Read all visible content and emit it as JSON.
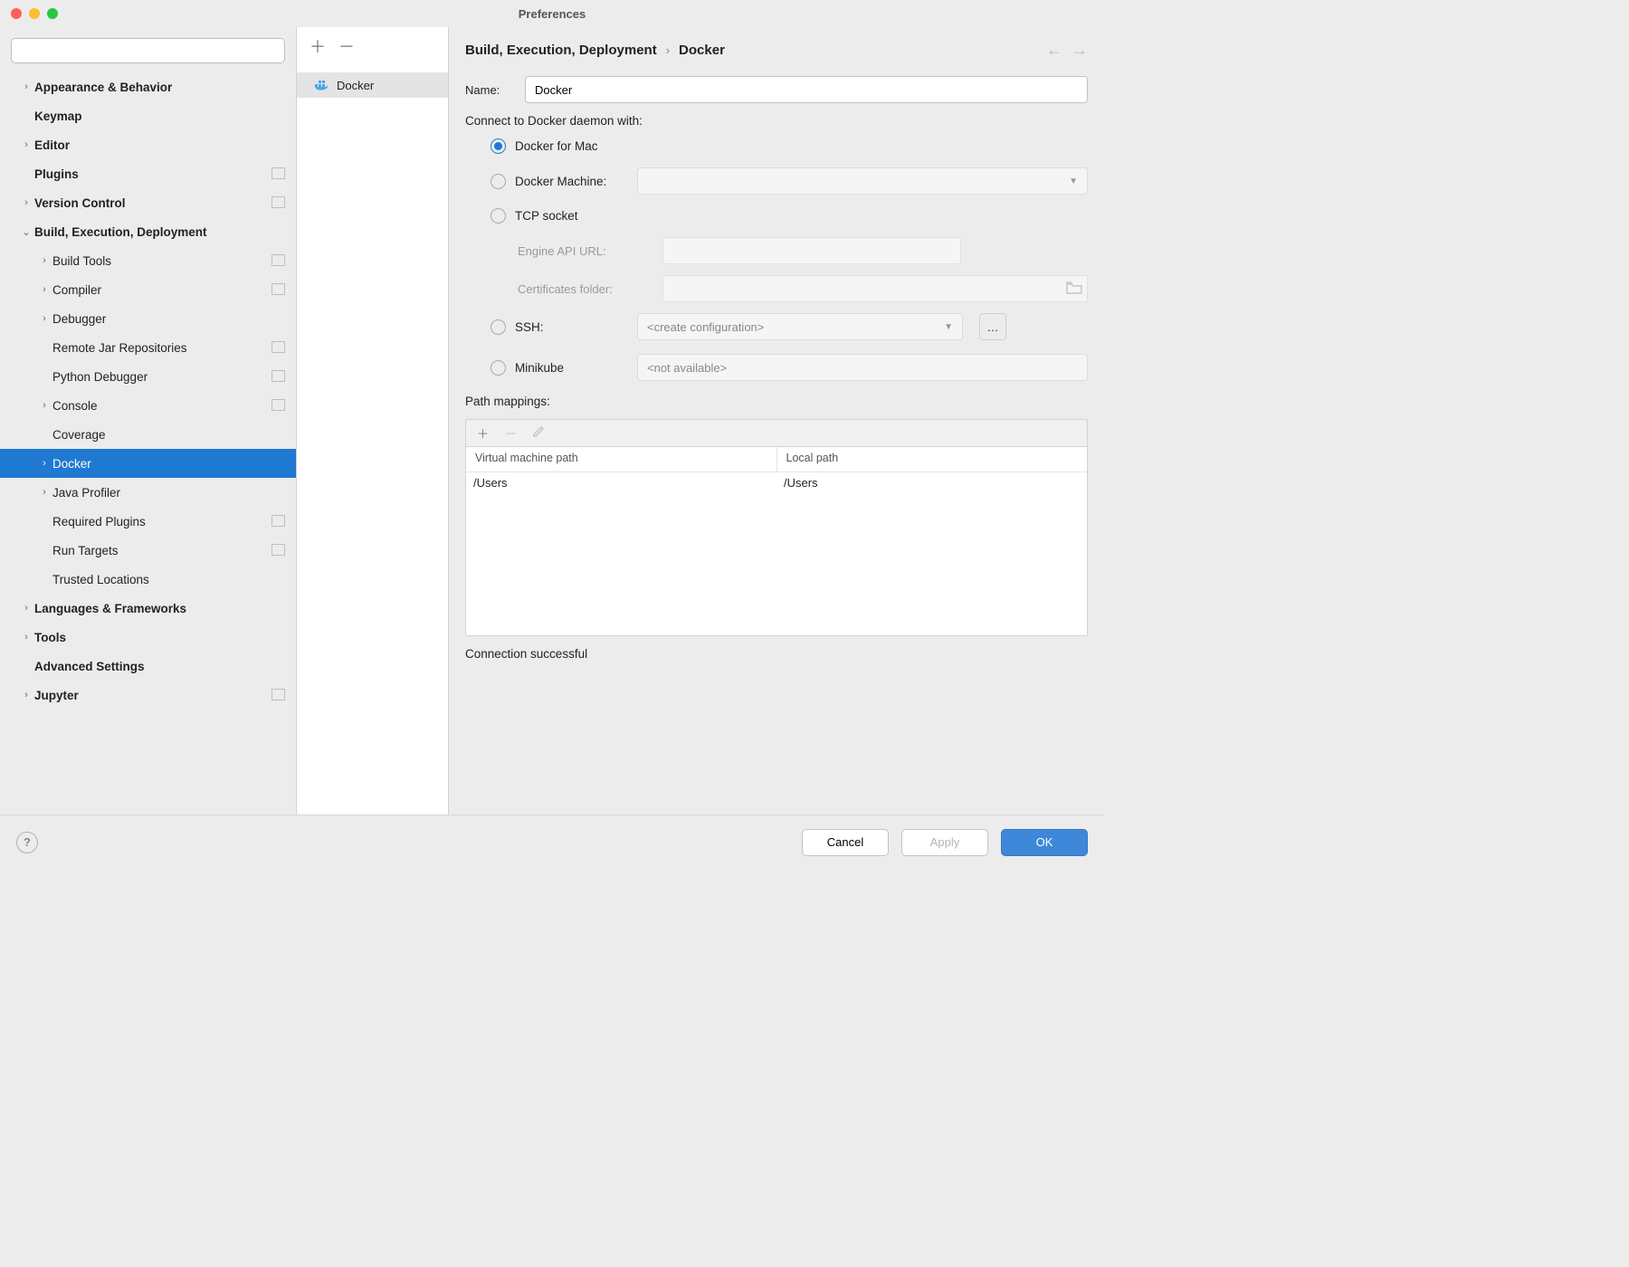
{
  "window": {
    "title": "Preferences"
  },
  "search": {
    "placeholder": ""
  },
  "sidebar": [
    {
      "label": "Appearance & Behavior",
      "bold": true,
      "arrow": ">",
      "level": 0
    },
    {
      "label": "Keymap",
      "bold": true,
      "arrow": "",
      "level": 0
    },
    {
      "label": "Editor",
      "bold": true,
      "arrow": ">",
      "level": 0
    },
    {
      "label": "Plugins",
      "bold": true,
      "arrow": "",
      "level": 0,
      "badge": true
    },
    {
      "label": "Version Control",
      "bold": true,
      "arrow": ">",
      "level": 0,
      "badge": true
    },
    {
      "label": "Build, Execution, Deployment",
      "bold": true,
      "arrow": "v",
      "level": 0
    },
    {
      "label": "Build Tools",
      "bold": false,
      "arrow": ">",
      "level": 1,
      "badge": true
    },
    {
      "label": "Compiler",
      "bold": false,
      "arrow": ">",
      "level": 1,
      "badge": true
    },
    {
      "label": "Debugger",
      "bold": false,
      "arrow": ">",
      "level": 1
    },
    {
      "label": "Remote Jar Repositories",
      "bold": false,
      "arrow": "",
      "level": 1,
      "badge": true
    },
    {
      "label": "Python Debugger",
      "bold": false,
      "arrow": "",
      "level": 1,
      "badge": true
    },
    {
      "label": "Console",
      "bold": false,
      "arrow": ">",
      "level": 1,
      "badge": true
    },
    {
      "label": "Coverage",
      "bold": false,
      "arrow": "",
      "level": 1
    },
    {
      "label": "Docker",
      "bold": false,
      "arrow": ">",
      "level": 1,
      "selected": true
    },
    {
      "label": "Java Profiler",
      "bold": false,
      "arrow": ">",
      "level": 1
    },
    {
      "label": "Required Plugins",
      "bold": false,
      "arrow": "",
      "level": 1,
      "badge": true
    },
    {
      "label": "Run Targets",
      "bold": false,
      "arrow": "",
      "level": 1,
      "badge": true
    },
    {
      "label": "Trusted Locations",
      "bold": false,
      "arrow": "",
      "level": 1
    },
    {
      "label": "Languages & Frameworks",
      "bold": true,
      "arrow": ">",
      "level": 0
    },
    {
      "label": "Tools",
      "bold": true,
      "arrow": ">",
      "level": 0
    },
    {
      "label": "Advanced Settings",
      "bold": true,
      "arrow": "",
      "level": 0
    },
    {
      "label": "Jupyter",
      "bold": true,
      "arrow": ">",
      "level": 0,
      "badge": true
    }
  ],
  "middle": {
    "item": "Docker"
  },
  "breadcrumb": {
    "a": "Build, Execution, Deployment",
    "b": "Docker"
  },
  "form": {
    "name_label": "Name:",
    "name_value": "Docker",
    "connect_label": "Connect to Docker daemon with:",
    "options": {
      "docker_for_mac": "Docker for Mac",
      "docker_machine": "Docker Machine:",
      "tcp": "TCP socket",
      "engine_url": "Engine API URL:",
      "cert_folder": "Certificates folder:",
      "ssh": "SSH:",
      "ssh_value": "<create configuration>",
      "minikube": "Minikube",
      "minikube_value": "<not available>"
    },
    "path_label": "Path mappings:",
    "path_headers": {
      "vm": "Virtual machine path",
      "local": "Local path"
    },
    "path_row": {
      "vm": "/Users",
      "local": "/Users"
    },
    "status": "Connection successful"
  },
  "buttons": {
    "cancel": "Cancel",
    "apply": "Apply",
    "ok": "OK"
  }
}
